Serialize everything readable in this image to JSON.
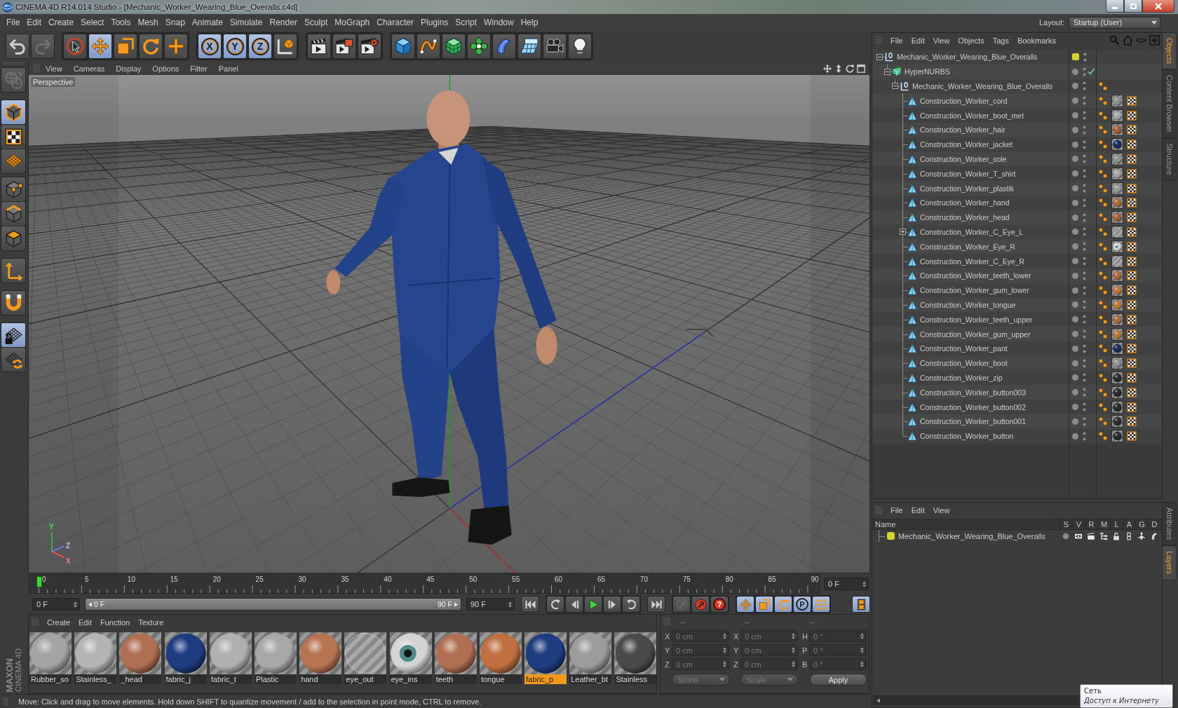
{
  "window": {
    "title": "CINEMA 4D R14.014 Studio - [Mechanic_Worker_Wearing_Blue_Overalls.c4d]"
  },
  "menu_bar": {
    "items": [
      "File",
      "Edit",
      "Create",
      "Select",
      "Tools",
      "Mesh",
      "Snap",
      "Animate",
      "Simulate",
      "Render",
      "Sculpt",
      "MoGraph",
      "Character",
      "Plugins",
      "Script",
      "Window",
      "Help"
    ],
    "layout_label": "Layout:",
    "layout_value": "Startup (User)"
  },
  "toolbar": [
    {
      "kind": "undo",
      "selected": false,
      "disabled": false
    },
    {
      "kind": "redo",
      "selected": false,
      "disabled": true
    },
    {
      "kind": "group",
      "tools": [
        {
          "kind": "live_select",
          "selected": false,
          "disabled": false
        },
        {
          "kind": "move",
          "selected": true,
          "disabled": false
        },
        {
          "kind": "scale",
          "selected": false,
          "disabled": false
        },
        {
          "kind": "rotate",
          "selected": false,
          "disabled": false
        },
        {
          "kind": "add",
          "selected": false,
          "disabled": false
        }
      ]
    },
    {
      "kind": "group",
      "tools": [
        {
          "kind": "axis_lock",
          "label": "X",
          "selected": true,
          "disabled": false
        },
        {
          "kind": "axis_lock",
          "label": "Y",
          "selected": true,
          "disabled": false
        },
        {
          "kind": "axis_lock",
          "label": "Z",
          "selected": true,
          "disabled": false
        },
        {
          "kind": "coordinate_system",
          "selected": false,
          "disabled": false
        }
      ]
    },
    {
      "kind": "group",
      "tools": [
        {
          "kind": "render_view",
          "selected": false,
          "disabled": false
        },
        {
          "kind": "render_viewer",
          "selected": false,
          "disabled": false
        },
        {
          "kind": "render_settings",
          "selected": false,
          "disabled": false
        }
      ]
    },
    {
      "kind": "group",
      "tools": [
        {
          "kind": "cube",
          "selected": false,
          "disabled": false
        },
        {
          "kind": "spline",
          "selected": false,
          "disabled": false
        },
        {
          "kind": "subdivision",
          "selected": false,
          "disabled": false
        },
        {
          "kind": "cloner",
          "selected": false,
          "disabled": false
        },
        {
          "kind": "deformer",
          "selected": false,
          "disabled": false
        },
        {
          "kind": "floor",
          "selected": false,
          "disabled": false
        },
        {
          "kind": "camera",
          "selected": false,
          "disabled": false
        },
        {
          "kind": "light",
          "selected": false,
          "disabled": false
        }
      ]
    }
  ],
  "mode_toolbar": [
    {
      "tools": [
        {
          "kind": "make_editable",
          "selected": false,
          "disabled": true
        }
      ]
    },
    {
      "tools": [
        {
          "kind": "model",
          "selected": true,
          "disabled": false
        },
        {
          "kind": "texture",
          "selected": false,
          "disabled": false
        },
        {
          "kind": "workplane",
          "selected": false,
          "disabled": false
        }
      ]
    },
    {
      "tools": [
        {
          "kind": "points",
          "selected": false,
          "disabled": false
        },
        {
          "kind": "edges",
          "selected": false,
          "disabled": false
        },
        {
          "kind": "polygons",
          "selected": false,
          "disabled": false
        }
      ]
    },
    {
      "tools": [
        {
          "kind": "axis",
          "selected": false,
          "disabled": false
        }
      ]
    },
    {
      "tools": [
        {
          "kind": "snap",
          "selected": false,
          "disabled": false
        }
      ]
    },
    {
      "tools": [
        {
          "kind": "workplane_lock",
          "selected": true,
          "disabled": false
        },
        {
          "kind": "workplane_sync",
          "selected": false,
          "disabled": false
        }
      ]
    }
  ],
  "viewport": {
    "menu": [
      "View",
      "Cameras",
      "Display",
      "Options",
      "Filter",
      "Panel"
    ],
    "camera_label": "Perspective",
    "axis_labels": [
      "Y",
      "Z",
      "X"
    ]
  },
  "timeline": {
    "ticks": [
      "0",
      "5",
      "10",
      "15",
      "20",
      "25",
      "30",
      "35",
      "40",
      "45",
      "50",
      "55",
      "60",
      "65",
      "70",
      "75",
      "80",
      "85",
      "90"
    ],
    "level": 0,
    "frame_field": "0 F"
  },
  "transport": {
    "start_field": "0 F",
    "range": {
      "start": "0 F",
      "end": "90 F",
      "level": 1
    },
    "end_field": "90 F",
    "controls": [
      {
        "kind": "to_start",
        "selected": false,
        "disabled": false
      },
      {
        "kind": "group",
        "buttons": [
          {
            "kind": "prev_key",
            "selected": false,
            "disabled": false
          },
          {
            "kind": "prev_frame",
            "selected": false,
            "disabled": false
          },
          {
            "kind": "play",
            "selected": false,
            "disabled": false
          },
          {
            "kind": "next_frame",
            "selected": false,
            "disabled": false
          },
          {
            "kind": "next_key",
            "selected": false,
            "disabled": false
          }
        ]
      },
      {
        "kind": "to_end",
        "selected": false,
        "disabled": false
      },
      {
        "kind": "group",
        "buttons": [
          {
            "kind": "autokey",
            "selected": false,
            "disabled": true
          },
          {
            "kind": "record",
            "selected": false,
            "disabled": false
          },
          {
            "kind": "key_selection",
            "label": "?",
            "selected": false,
            "disabled": false
          }
        ]
      },
      {
        "kind": "group",
        "buttons": [
          {
            "kind": "key_move",
            "selected": true,
            "disabled": false
          },
          {
            "kind": "key_scale",
            "selected": true,
            "disabled": false
          },
          {
            "kind": "key_rotate",
            "selected": true,
            "disabled": false
          },
          {
            "kind": "key_param",
            "label": "P",
            "selected": true,
            "disabled": false
          },
          {
            "kind": "key_pla",
            "selected": true,
            "disabled": false
          }
        ]
      },
      {
        "kind": "timeline",
        "selected": true,
        "disabled": false
      }
    ]
  },
  "logo": {
    "brand": "MAXON",
    "product": "CINEMA 4D"
  },
  "material_manager": {
    "menu": [
      "Create",
      "Edit",
      "Function",
      "Texture"
    ],
    "materials": [
      {
        "name": "Rubber_so",
        "kind": "sphere",
        "color": "#a4a4a4",
        "selected": false
      },
      {
        "name": "Stainless_",
        "kind": "sphere",
        "color": "#b4b4b4",
        "selected": false
      },
      {
        "name": "_head",
        "kind": "sphere",
        "color": "#b06e52",
        "selected": false
      },
      {
        "name": "fabric_j",
        "kind": "sphere",
        "color": "#1e3c80",
        "selected": false
      },
      {
        "name": "fabric_t",
        "kind": "sphere",
        "color": "#b0b0b0",
        "selected": false
      },
      {
        "name": "Plastic",
        "kind": "sphere",
        "color": "#a8a8a8",
        "selected": false
      },
      {
        "name": "hand",
        "kind": "sphere",
        "color": "#b77450",
        "selected": false
      },
      {
        "name": "eye_out",
        "kind": "clear",
        "selected": false
      },
      {
        "name": "eye_ins",
        "kind": "eye",
        "color": "#d4d4d4",
        "selected": false
      },
      {
        "name": "teeth",
        "kind": "sphere",
        "color": "#b06e52",
        "selected": false
      },
      {
        "name": "tongue",
        "kind": "sphere",
        "color": "#c07040",
        "selected": false
      },
      {
        "name": "fabric_p",
        "kind": "sphere",
        "color": "#1e3c80",
        "selected": true
      },
      {
        "name": "Leather_bt",
        "kind": "sphere",
        "color": "#9c9c9c",
        "selected": false
      },
      {
        "name": "Stainless",
        "kind": "sphere",
        "color": "#4a4a4a",
        "selected": false
      }
    ]
  },
  "coordinates": {
    "disabled": true,
    "headers": [
      "--",
      "--",
      "--"
    ],
    "rows": [
      {
        "fields": [
          {
            "label": "X",
            "value": "0 cm"
          },
          {
            "label": "X",
            "value": "0 cm"
          },
          {
            "label": "H",
            "value": "0 °"
          }
        ]
      },
      {
        "fields": [
          {
            "label": "Y",
            "value": "0 cm"
          },
          {
            "label": "Y",
            "value": "0 cm"
          },
          {
            "label": "P",
            "value": "0 °"
          }
        ]
      },
      {
        "fields": [
          {
            "label": "Z",
            "value": "0 cm"
          },
          {
            "label": "Z",
            "value": "0 cm"
          },
          {
            "label": "B",
            "value": "0 °"
          }
        ]
      }
    ],
    "dropdowns": [
      "World",
      "Scale"
    ],
    "apply": "Apply"
  },
  "status_bar": "Move: Click and drag to move elements. Hold down SHIFT to quantize movement / add to the selection in point mode, CTRL to remove.",
  "object_manager": {
    "menu": [
      "File",
      "Edit",
      "View",
      "Objects",
      "Tags",
      "Bookmarks"
    ],
    "objects": [
      {
        "name": "Mechanic_Worker_Wearing_Blue_Overalls",
        "kind": "null",
        "expanded": true,
        "color": "#d8d22e",
        "children": [
          {
            "name": "HyperNURBS",
            "kind": "subdivision",
            "expanded": true,
            "enabled": true,
            "children": [
              {
                "name": "Mechanic_Worker_Wearing_Blue_Overalls",
                "kind": "null",
                "expanded": true,
                "tags": [
                  {
                    "kind": "phong"
                  }
                ],
                "children": [
                  {
                    "name": "Construction_Worker_cord",
                    "kind": "polygon",
                    "tags": [
                      {
                        "kind": "phong"
                      },
                      {
                        "kind": "material_sphere",
                        "color": "#8d8d8d"
                      },
                      {
                        "kind": "uvw"
                      }
                    ]
                  },
                  {
                    "name": "Construction_Worker_boot_met",
                    "kind": "polygon",
                    "tags": [
                      {
                        "kind": "phong"
                      },
                      {
                        "kind": "material_sphere",
                        "color": "#a5a5a5"
                      },
                      {
                        "kind": "uvw"
                      }
                    ]
                  },
                  {
                    "name": "Construction_Worker_hair",
                    "kind": "polygon",
                    "tags": [
                      {
                        "kind": "phong"
                      },
                      {
                        "kind": "material_sphere",
                        "color": "#9c5f36"
                      },
                      {
                        "kind": "uvw"
                      }
                    ]
                  },
                  {
                    "name": "Construction_Worker_jacket",
                    "kind": "polygon",
                    "tags": [
                      {
                        "kind": "phong"
                      },
                      {
                        "kind": "material_sphere",
                        "color": "#1b2d5c"
                      },
                      {
                        "kind": "uvw"
                      }
                    ]
                  },
                  {
                    "name": "Construction_Worker_sole",
                    "kind": "polygon",
                    "tags": [
                      {
                        "kind": "phong"
                      },
                      {
                        "kind": "material_sphere",
                        "color": "#8f8f8f"
                      },
                      {
                        "kind": "uvw"
                      }
                    ]
                  },
                  {
                    "name": "Construction_Worker_T_shirt",
                    "kind": "polygon",
                    "tags": [
                      {
                        "kind": "phong"
                      },
                      {
                        "kind": "material_sphere",
                        "color": "#a3a3a3"
                      },
                      {
                        "kind": "uvw"
                      }
                    ]
                  },
                  {
                    "name": "Construction_Worker_plastik",
                    "kind": "polygon",
                    "tags": [
                      {
                        "kind": "phong"
                      },
                      {
                        "kind": "material_sphere",
                        "color": "#989898"
                      },
                      {
                        "kind": "uvw"
                      }
                    ]
                  },
                  {
                    "name": "Construction_Worker_hand",
                    "kind": "polygon",
                    "tags": [
                      {
                        "kind": "phong"
                      },
                      {
                        "kind": "material_sphere",
                        "color": "#a8693f"
                      },
                      {
                        "kind": "uvw"
                      }
                    ]
                  },
                  {
                    "name": "Construction_Worker_head",
                    "kind": "polygon",
                    "tags": [
                      {
                        "kind": "phong"
                      },
                      {
                        "kind": "material_sphere",
                        "color": "#a0603a"
                      },
                      {
                        "kind": "uvw"
                      }
                    ]
                  },
                  {
                    "name": "Construction_Worker_C_Eye_L",
                    "kind": "polygon",
                    "expanded": false,
                    "tags": [
                      {
                        "kind": "phong"
                      },
                      {
                        "kind": "material_clear"
                      },
                      {
                        "kind": "uvw"
                      }
                    ]
                  },
                  {
                    "name": "Construction_Worker_Eye_R",
                    "kind": "polygon",
                    "tags": [
                      {
                        "kind": "phong"
                      },
                      {
                        "kind": "material_eye",
                        "color": "#cfcfcf"
                      },
                      {
                        "kind": "uvw"
                      }
                    ]
                  },
                  {
                    "name": "Construction_Worker_C_Eye_R",
                    "kind": "polygon",
                    "tags": [
                      {
                        "kind": "phong"
                      },
                      {
                        "kind": "material_clear"
                      },
                      {
                        "kind": "uvw"
                      }
                    ]
                  },
                  {
                    "name": "Construction_Worker_teeth_lower",
                    "kind": "polygon",
                    "tags": [
                      {
                        "kind": "phong"
                      },
                      {
                        "kind": "material_sphere",
                        "color": "#a66a40"
                      },
                      {
                        "kind": "uvw"
                      }
                    ]
                  },
                  {
                    "name": "Construction_Worker_gum_lower",
                    "kind": "polygon",
                    "tags": [
                      {
                        "kind": "phong"
                      },
                      {
                        "kind": "material_sphere",
                        "color": "#b8763e"
                      },
                      {
                        "kind": "uvw"
                      }
                    ]
                  },
                  {
                    "name": "Construction_Worker_tongue",
                    "kind": "polygon",
                    "tags": [
                      {
                        "kind": "phong"
                      },
                      {
                        "kind": "material_sphere",
                        "color": "#b8763e"
                      },
                      {
                        "kind": "uvw"
                      }
                    ]
                  },
                  {
                    "name": "Construction_Worker_teeth_upper",
                    "kind": "polygon",
                    "tags": [
                      {
                        "kind": "phong"
                      },
                      {
                        "kind": "material_sphere",
                        "color": "#a66a40"
                      },
                      {
                        "kind": "uvw"
                      }
                    ]
                  },
                  {
                    "name": "Construction_Worker_gum_upper",
                    "kind": "polygon",
                    "tags": [
                      {
                        "kind": "phong"
                      },
                      {
                        "kind": "material_sphere",
                        "color": "#b8763e"
                      },
                      {
                        "kind": "uvw"
                      }
                    ]
                  },
                  {
                    "name": "Construction_Worker_pant",
                    "kind": "polygon",
                    "tags": [
                      {
                        "kind": "phong"
                      },
                      {
                        "kind": "material_sphere",
                        "color": "#1b2d5c"
                      },
                      {
                        "kind": "uvw"
                      }
                    ]
                  },
                  {
                    "name": "Construction_Worker_boot",
                    "kind": "polygon",
                    "tags": [
                      {
                        "kind": "phong"
                      },
                      {
                        "kind": "material_sphere",
                        "color": "#8f8f8f"
                      },
                      {
                        "kind": "uvw"
                      }
                    ]
                  },
                  {
                    "name": "Construction_Worker_zip",
                    "kind": "polygon",
                    "tags": [
                      {
                        "kind": "phong"
                      },
                      {
                        "kind": "material_sphere",
                        "color": "#2a2a2a"
                      },
                      {
                        "kind": "uvw"
                      }
                    ]
                  },
                  {
                    "name": "Construction_Worker_button003",
                    "kind": "polygon",
                    "tags": [
                      {
                        "kind": "phong"
                      },
                      {
                        "kind": "material_sphere",
                        "color": "#2a2a2a"
                      },
                      {
                        "kind": "uvw"
                      }
                    ]
                  },
                  {
                    "name": "Construction_Worker_button002",
                    "kind": "polygon",
                    "tags": [
                      {
                        "kind": "phong"
                      },
                      {
                        "kind": "material_sphere",
                        "color": "#2a2a2a"
                      },
                      {
                        "kind": "uvw"
                      }
                    ]
                  },
                  {
                    "name": "Construction_Worker_button001",
                    "kind": "polygon",
                    "tags": [
                      {
                        "kind": "phong"
                      },
                      {
                        "kind": "material_sphere",
                        "color": "#2a2a2a"
                      },
                      {
                        "kind": "uvw"
                      }
                    ]
                  },
                  {
                    "name": "Construction_Worker_button",
                    "kind": "polygon",
                    "tags": [
                      {
                        "kind": "phong"
                      },
                      {
                        "kind": "material_sphere",
                        "color": "#2a2a2a"
                      },
                      {
                        "kind": "uvw"
                      }
                    ]
                  }
                ]
              }
            ]
          }
        ]
      }
    ]
  },
  "layer_manager": {
    "menu": [
      "File",
      "Edit",
      "View"
    ],
    "columns": [
      "Name",
      "S",
      "V",
      "R",
      "M",
      "L",
      "A",
      "G",
      "D"
    ],
    "layers": [
      {
        "name": "Mechanic_Worker_Wearing_Blue_Overalls",
        "color": "#d8d22e",
        "solo": false,
        "visible": true,
        "render": true,
        "manager": true,
        "locked": false,
        "animation": true,
        "generators": true,
        "deformers": true
      }
    ]
  },
  "side_tabs": {
    "top": [
      {
        "label": "Objects",
        "selected": true
      },
      {
        "label": "Content Browser",
        "selected": false
      },
      {
        "label": "Structure",
        "selected": false
      }
    ],
    "bottom": [
      {
        "label": "Attributes",
        "selected": false
      },
      {
        "label": "Layers",
        "selected": true
      }
    ]
  },
  "tooltip": {
    "title": "Сеть",
    "text": "Доступ к Интернету"
  }
}
